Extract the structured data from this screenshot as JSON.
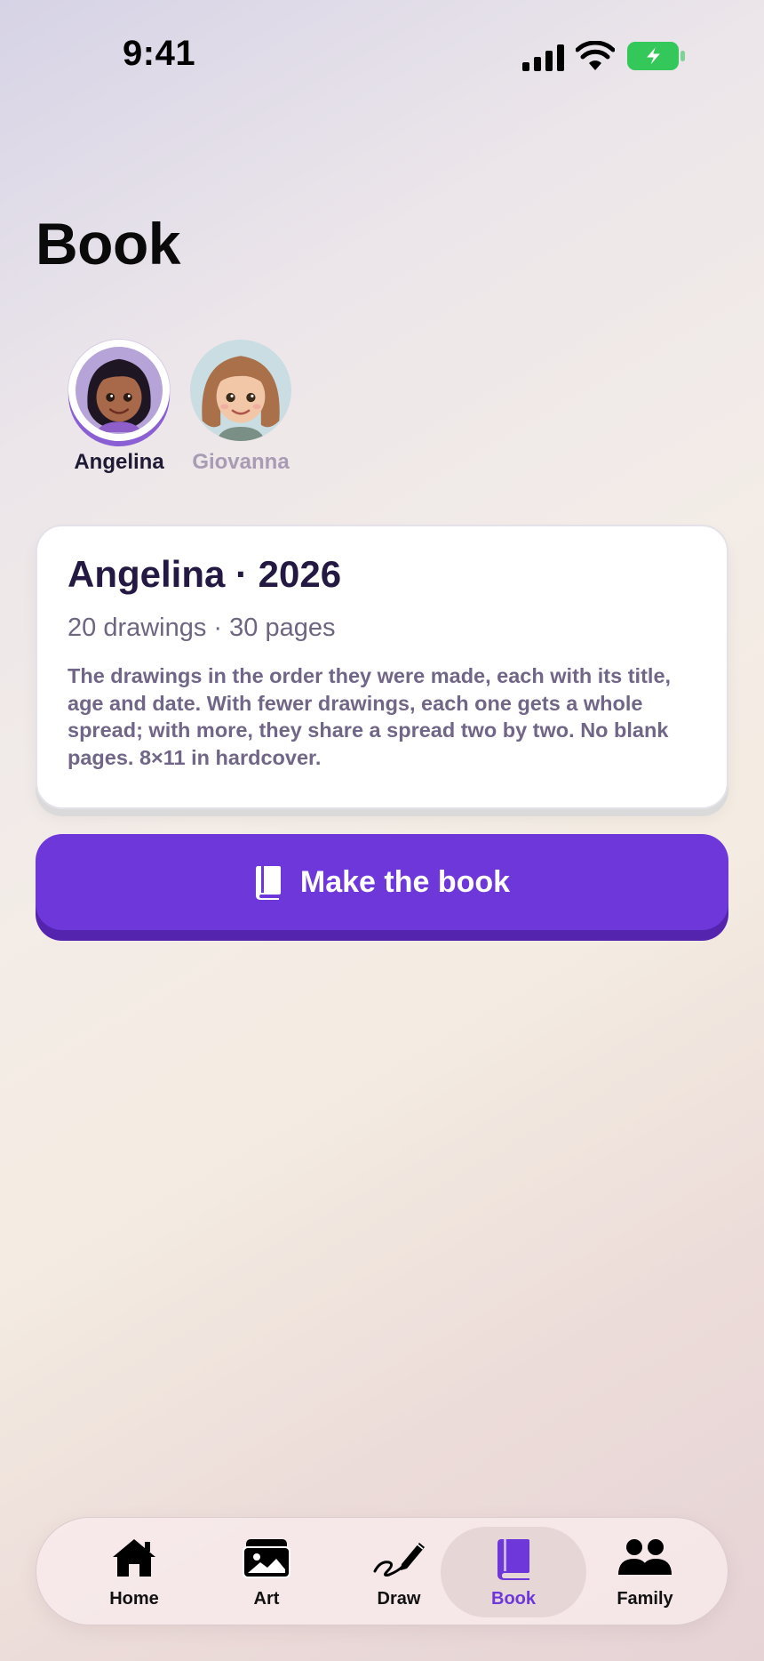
{
  "status_bar": {
    "time": "9:41"
  },
  "page": {
    "title": "Book"
  },
  "profiles": [
    {
      "name": "Angelina",
      "selected": true
    },
    {
      "name": "Giovanna",
      "selected": false
    }
  ],
  "book_card": {
    "title": "Angelina · 2026",
    "stats": "20 drawings · 30 pages",
    "description": "The drawings in the order they were made, each with its title, age and date. With fewer drawings, each one gets a whole spread; with more, they share a spread two by two. No blank pages. 8×11 in hardcover."
  },
  "cta": {
    "label": "Make the book",
    "icon": "book-icon"
  },
  "tabs": [
    {
      "label": "Home",
      "icon": "home-icon",
      "active": false
    },
    {
      "label": "Art",
      "icon": "photos-icon",
      "active": false
    },
    {
      "label": "Draw",
      "icon": "draw-icon",
      "active": false
    },
    {
      "label": "Book",
      "icon": "book-icon",
      "active": true
    },
    {
      "label": "Family",
      "icon": "family-icon",
      "active": false
    }
  ],
  "colors": {
    "accent": "#6e37da",
    "accent_dark": "#5424ae",
    "card_title": "#241942",
    "battery_green": "#34c759"
  }
}
